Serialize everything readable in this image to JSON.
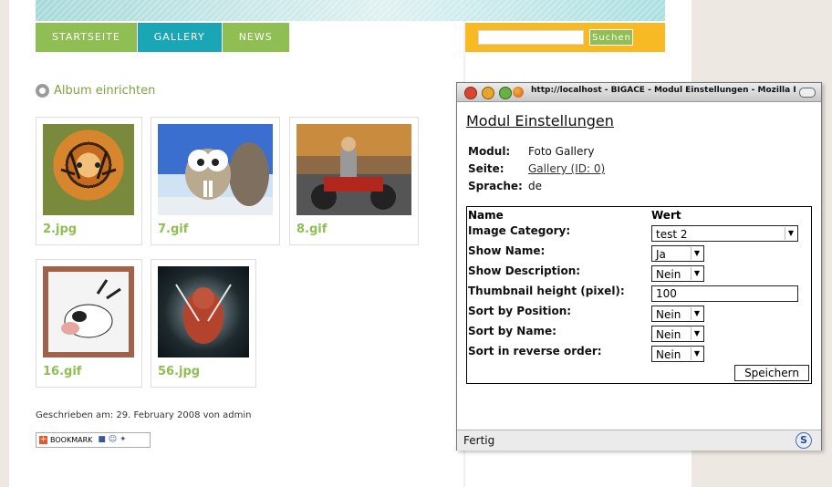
{
  "nav": {
    "items": [
      {
        "label": "STARTSEITE"
      },
      {
        "label": "GALLERY"
      },
      {
        "label": "NEWS"
      }
    ]
  },
  "search": {
    "value": "",
    "button_label": "Suchen"
  },
  "album": {
    "link_label": "Album einrichten"
  },
  "gallery": {
    "images": [
      {
        "name": "2.jpg",
        "icon": "tiger-photo"
      },
      {
        "name": "7.gif",
        "icon": "squirrel-image"
      },
      {
        "name": "8.gif",
        "icon": "motorcycle-image"
      },
      {
        "name": "16.gif",
        "icon": "cow-image"
      },
      {
        "name": "56.jpg",
        "icon": "monster-image"
      }
    ]
  },
  "footer": {
    "written_text": "Geschrieben am: 29. February 2008 von admin",
    "bookmark_label": "BOOKMARK"
  },
  "popup": {
    "window_title": "http://localhost - BIGACE - Modul Einstellungen - Mozilla Fi...",
    "heading": "Modul Einstellungen",
    "info": [
      {
        "label": "Modul:",
        "value": "Foto Gallery",
        "link": false
      },
      {
        "label": "Seite:",
        "value": "Gallery (ID: 0)",
        "link": true
      },
      {
        "label": "Sprache:",
        "value": "de",
        "link": false
      }
    ],
    "table": {
      "col_name": "Name",
      "col_value": "Wert",
      "rows": [
        {
          "label": "Image Category:",
          "value": "test 2"
        },
        {
          "label": "Show Name:",
          "value": "Ja"
        },
        {
          "label": "Show Description:",
          "value": "Nein"
        },
        {
          "label": "Thumbnail height (pixel):",
          "value": "100"
        },
        {
          "label": "Sort by Position:",
          "value": "Nein"
        },
        {
          "label": "Sort by Name:",
          "value": "Nein"
        },
        {
          "label": "Sort in reverse order:",
          "value": "Nein"
        }
      ],
      "save_label": "Speichern"
    },
    "status": "Fertig",
    "status_icon": "S"
  },
  "colors": {
    "nav_green": "#8fbe52",
    "nav_teal": "#1ba6b5",
    "search_bg": "#f7b924",
    "link_green": "#7ba33e"
  }
}
